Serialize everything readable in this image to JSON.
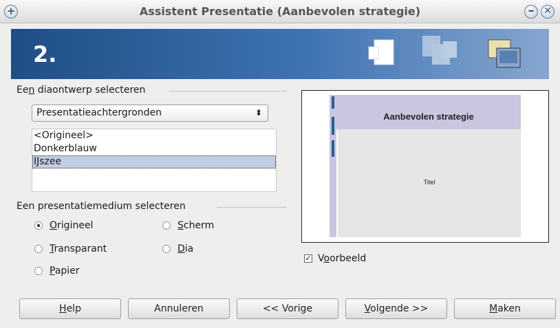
{
  "window": {
    "title": "Assistent Presentatie (Aanbevolen strategie)"
  },
  "banner": {
    "step": "2."
  },
  "design": {
    "section_label_pre": "Ee",
    "section_label_mnemonic": "n",
    "section_label_post": " diaontwerp selecteren",
    "category_value": "Presentatieachtergronden",
    "templates": [
      "<Origineel>",
      "Donkerblauw",
      "IJszee"
    ],
    "selected_template": "IJszee"
  },
  "medium": {
    "section_label": "Een presentatiemedium selecteren",
    "options": [
      {
        "mnemonic": "O",
        "rest": "rigineel",
        "selected": true
      },
      {
        "mnemonic": "S",
        "rest": "cherm",
        "selected": false
      },
      {
        "mnemonic": "T",
        "rest": "ransparant",
        "selected": false
      },
      {
        "mnemonic": "D",
        "rest": "ia",
        "selected": false
      },
      {
        "mnemonic": "P",
        "rest": "apier",
        "selected": false
      }
    ]
  },
  "preview": {
    "slide_title": "Aanbevolen strategie",
    "slide_subtitle": "Titel",
    "checkbox_pre": "V",
    "checkbox_mnemonic": "o",
    "checkbox_post": "orbeeld",
    "checked": true
  },
  "buttons": {
    "help_mnemonic": "H",
    "help_rest": "elp",
    "cancel": "Annuleren",
    "prev": "<< Vorige",
    "next_mnemonic": "V",
    "next_rest": "olgende >>",
    "finish_mnemonic": "M",
    "finish_rest": "aken"
  }
}
